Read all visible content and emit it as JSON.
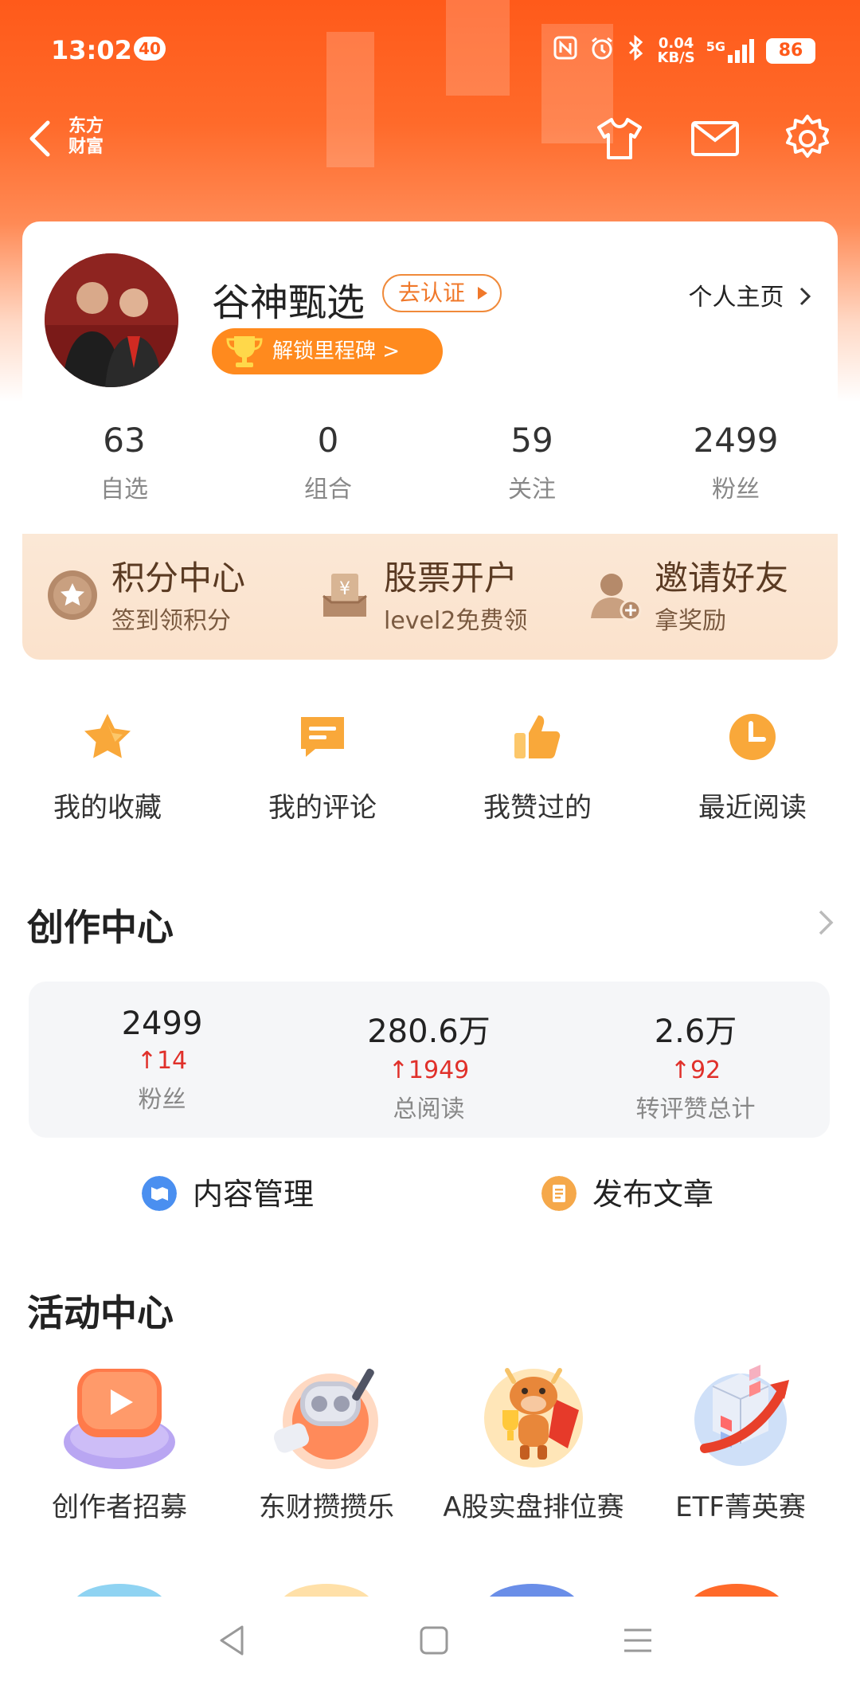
{
  "status_bar": {
    "time": "13:02",
    "notification_count": "40",
    "net_speed_value": "0.04",
    "net_speed_unit": "KB/S",
    "network_type": "5G",
    "battery": "86"
  },
  "toolbar": {
    "brand_line1": "东方",
    "brand_line2": "财富"
  },
  "profile": {
    "name": "谷神甄选",
    "verify_label": "去认证",
    "homepage_label": "个人主页",
    "milestone_label": "解锁里程碑 >",
    "stats": [
      {
        "value": "63",
        "label": "自选"
      },
      {
        "value": "0",
        "label": "组合"
      },
      {
        "value": "59",
        "label": "关注"
      },
      {
        "value": "2499",
        "label": "粉丝"
      }
    ]
  },
  "promo": [
    {
      "title": "积分中心",
      "subtitle": "签到领积分",
      "icon": "star-coin-icon"
    },
    {
      "title": "股票开户",
      "subtitle": "level2免费领",
      "icon": "yuan-box-icon"
    },
    {
      "title": "邀请好友",
      "subtitle": "拿奖励",
      "icon": "add-friend-icon"
    }
  ],
  "quick_actions": [
    {
      "label": "我的收藏",
      "icon": "star-icon"
    },
    {
      "label": "我的评论",
      "icon": "comment-icon"
    },
    {
      "label": "我赞过的",
      "icon": "thumbs-up-icon"
    },
    {
      "label": "最近阅读",
      "icon": "clock-icon"
    }
  ],
  "creation_center": {
    "title": "创作中心",
    "stats": [
      {
        "value": "2499",
        "delta": "14",
        "label": "粉丝"
      },
      {
        "value": "280.6万",
        "delta": "1949",
        "label": "总阅读"
      },
      {
        "value": "2.6万",
        "delta": "92",
        "label": "转评赞总计"
      }
    ],
    "actions": [
      {
        "label": "内容管理",
        "color": "#4a8ff0"
      },
      {
        "label": "发布文章",
        "color": "#f5a84a"
      }
    ]
  },
  "activity_center": {
    "title": "活动中心",
    "items": [
      {
        "label": "创作者招募"
      },
      {
        "label": "东财攒攒乐"
      },
      {
        "label": "A股实盘排位赛"
      },
      {
        "label": "ETF菁英赛"
      }
    ]
  },
  "colors": {
    "brand_orange": "#ff5a1a",
    "accent_orange": "#ff8a1e",
    "delta_red": "#e0302a",
    "promo_bg": "#fbe8d6"
  }
}
